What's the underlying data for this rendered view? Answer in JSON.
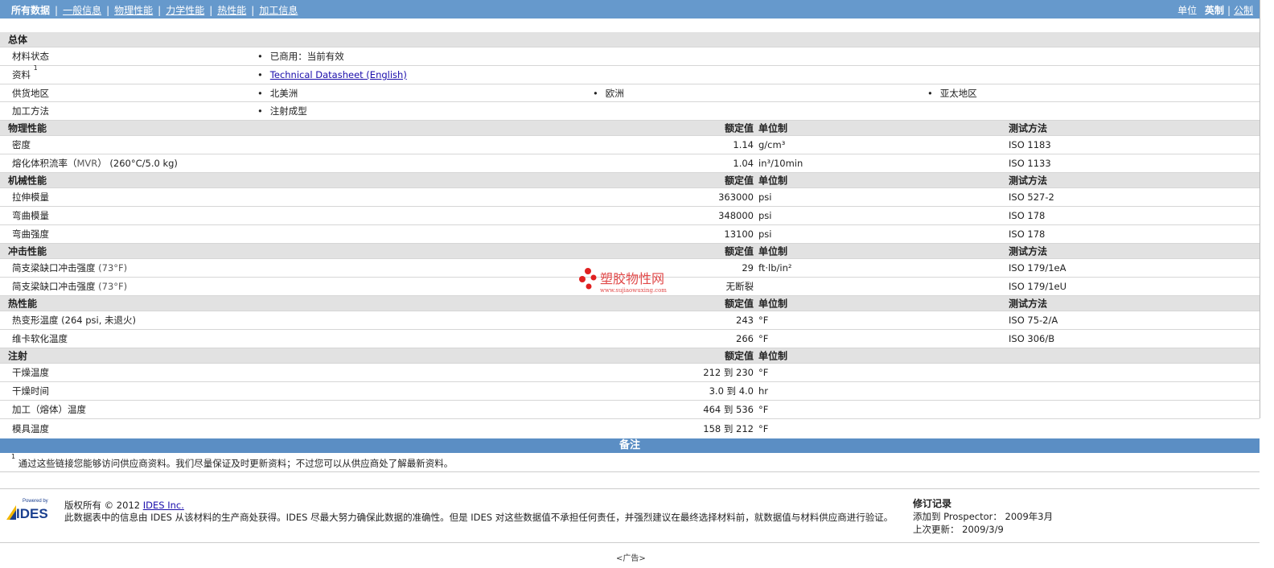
{
  "nav": {
    "items": [
      "所有数据",
      "一般信息",
      "物理性能",
      "力学性能",
      "热性能",
      "加工信息"
    ],
    "units_label": "单位",
    "unit_active": "英制",
    "unit_other": "公制"
  },
  "general": {
    "title": "总体",
    "rows": [
      {
        "label": "材料状态",
        "value": "已商用：当前有效"
      },
      {
        "label": "资料",
        "sup": "1",
        "value": "Technical Datasheet (English)"
      },
      {
        "label": "供货地区",
        "v1": "北美洲",
        "v2": "欧洲",
        "v3": "亚太地区"
      },
      {
        "label": "加工方法",
        "value": "注射成型"
      }
    ]
  },
  "col_headers": {
    "nominal": "额定值",
    "unit": "单位制",
    "method": "测试方法"
  },
  "physical": {
    "title": "物理性能",
    "rows": [
      {
        "label": "密度",
        "value": "1.14",
        "unit": "g/cm³",
        "method": "ISO 1183"
      },
      {
        "label": "熔化体积流率（",
        "label_mid": "MVR",
        "label_end": "）  (260°C/5.0 kg)",
        "value": "1.04",
        "unit": "in³/10min",
        "method": "ISO 1133"
      }
    ]
  },
  "mechanical": {
    "title": "机械性能",
    "rows": [
      {
        "label": "拉伸模量",
        "value": "363000",
        "unit": "psi",
        "method": "ISO 527-2"
      },
      {
        "label": "弯曲模量",
        "value": "348000",
        "unit": "psi",
        "method": "ISO 178"
      },
      {
        "label": "弯曲强度",
        "value": "13100",
        "unit": "psi",
        "method": "ISO 178"
      }
    ]
  },
  "impact": {
    "title": "冲击性能",
    "rows": [
      {
        "label": "简支梁缺口冲击强度",
        "cond": "(73°F)",
        "value": "29",
        "unit": "ft·lb/in²",
        "method": "ISO 179/1eA"
      },
      {
        "label": "简支梁缺口冲击强度",
        "cond": "(73°F)",
        "value": "无断裂",
        "unit": "",
        "method": "ISO 179/1eU"
      }
    ]
  },
  "thermal": {
    "title": "热性能",
    "rows": [
      {
        "label": "热变形温度",
        "cond": "(264 psi, 未退火)",
        "value": "243",
        "unit": "°F",
        "method": "ISO 75-2/A"
      },
      {
        "label": "维卡软化温度",
        "value": "266",
        "unit": "°F",
        "method": "ISO 306/B"
      }
    ]
  },
  "injection": {
    "title": "注射",
    "to": "到",
    "rows": [
      {
        "label": "干燥温度",
        "lo": "212",
        "hi": "230",
        "unit": "°F"
      },
      {
        "label": "干燥时间",
        "lo": "3.0",
        "hi": "4.0",
        "unit": "hr"
      },
      {
        "label": "加工（熔体）温度",
        "lo": "464",
        "hi": "536",
        "unit": "°F"
      },
      {
        "label": "模具温度",
        "lo": "158",
        "hi": "212",
        "unit": "°F"
      }
    ]
  },
  "notes": {
    "title": "备注",
    "sup": "1",
    "text": "通过这些链接您能够访问供应商资料。我们尽量保证及时更新资料；不过您可以从供应商处了解最新资料。"
  },
  "footer": {
    "logo_top": "Powered by",
    "logo_text": "IDES",
    "copyright": "版权所有 © 2012",
    "company": "IDES Inc.",
    "disclaimer": "此数据表中的信息由  IDES 从该材料的生产商处获得。IDES 尽最大努力确保此数据的准确性。但是  IDES 对这些数据值不承担任何责任，并强烈建议在最终选择材料前，就数据值与材料供应商进行验证。",
    "rev_title": "修订记录",
    "added_label": "添加到  Prospector：",
    "added_value": "2009年3月",
    "updated_label": "上次更新：",
    "updated_value": "2009/3/9",
    "ad": "<广告>"
  },
  "watermark": {
    "cn": "塑胶物性网",
    "url": "www.sujiaowuxing.com"
  }
}
